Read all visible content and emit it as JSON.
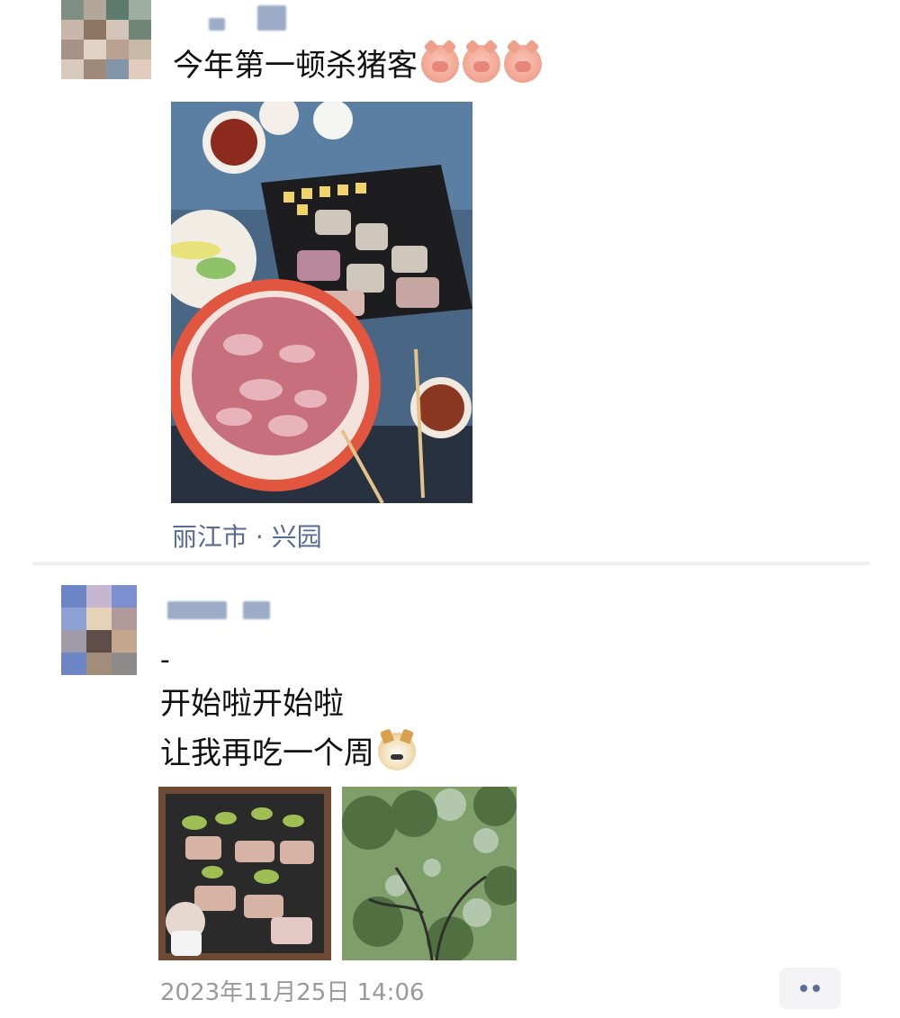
{
  "post1": {
    "caption": "今年第一顿杀猪客",
    "emojis": [
      "pig-face-icon",
      "pig-face-icon",
      "pig-face-icon"
    ],
    "location": "丽江市 · 兴园"
  },
  "post2": {
    "line0": "-",
    "line1": "开始啦开始啦",
    "line2": "让我再吃一个周",
    "emoji": "doge-face-icon",
    "timestamp": "2023年11月25日 14:06"
  },
  "colors": {
    "link": "#576b95",
    "meta": "#9a9a9a",
    "divider": "#efefef"
  }
}
